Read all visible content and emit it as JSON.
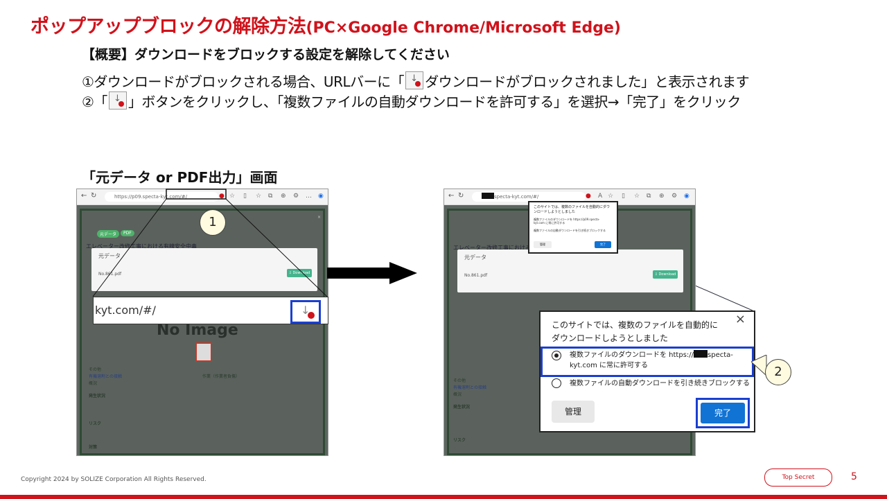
{
  "title": {
    "main": "ポップアップブロックの解除方法",
    "sub": "(PC×Google Chrome/Microsoft Edge)"
  },
  "summary": "【概要】ダウンロードをブロックする設定を解除してください",
  "steps": {
    "s1_before": "①ダウンロードがブロックされる場合、URLバーに「",
    "s1_after": "ダウンロードがブロックされました」と表示されます",
    "s2_before": "②「",
    "s2_after": "」ボタンをクリックし、「複数ファイルの自動ダウンロードを許可する」を選択→「完了」をクリック"
  },
  "screen_label": "「元データ or PDF出力」画面",
  "left_shot": {
    "url": "https://p09.specta-kyt.com/#/",
    "modal_title": "元データ",
    "file_name": "No.861.pdf",
    "download_btn": "⇩ Download",
    "tag1": "元データ",
    "tag2": "PDF",
    "heading_line": "エレベーター改修工事における有線安全中毒",
    "no_image": "No Image",
    "side1": "その他",
    "side2": "有機溶剤との接触",
    "side3": "概況",
    "status1": "発生状況",
    "risk": "リスク",
    "measure": "対策",
    "person": "作業（作業者負傷）"
  },
  "zoom": {
    "url_text": "kyt.com/#/"
  },
  "callouts": {
    "one": "1",
    "two": "2"
  },
  "right_shot": {
    "url_tail": "specta-kyt.com/#/",
    "modal_title": "元データ",
    "file_name": "No.861.pdf",
    "download_btn": "⇩ Download",
    "no_image": "No Image",
    "side1": "その他",
    "side2": "有機溶剤との接触",
    "side3": "概況",
    "status1": "発生状況",
    "risk": "リスク"
  },
  "popup_small": {
    "title": "このサイトでは、複数のファイルを自動的にダウンロードしようとしました",
    "opt1": "複数ファイルのダウンロードを https://p09.specta-kyt.com に常に許可する",
    "opt2": "複数ファイルの自動ダウンロードを引き続きブロックする",
    "manage": "管理",
    "done": "完了"
  },
  "popup": {
    "title": "このサイトでは、複数のファイルを自動的にダウンロードしようとしました",
    "opt1_a": "複数ファイルのダウンロードを https://",
    "opt1_b": "specta-",
    "opt1_c": "kyt.com に常に許可する",
    "opt2": "複数ファイルの自動ダウンロードを引き続きブロックする",
    "manage": "管理",
    "done": "完了"
  },
  "footer": {
    "copyright": "Copyright 2024 by SOLIZE Corporation All Rights Reserved.",
    "badge": "Top Secret",
    "page": "5"
  },
  "colors": {
    "accent": "#d0121b",
    "highlight": "#1a3fcf",
    "done_button": "#1173d4"
  }
}
